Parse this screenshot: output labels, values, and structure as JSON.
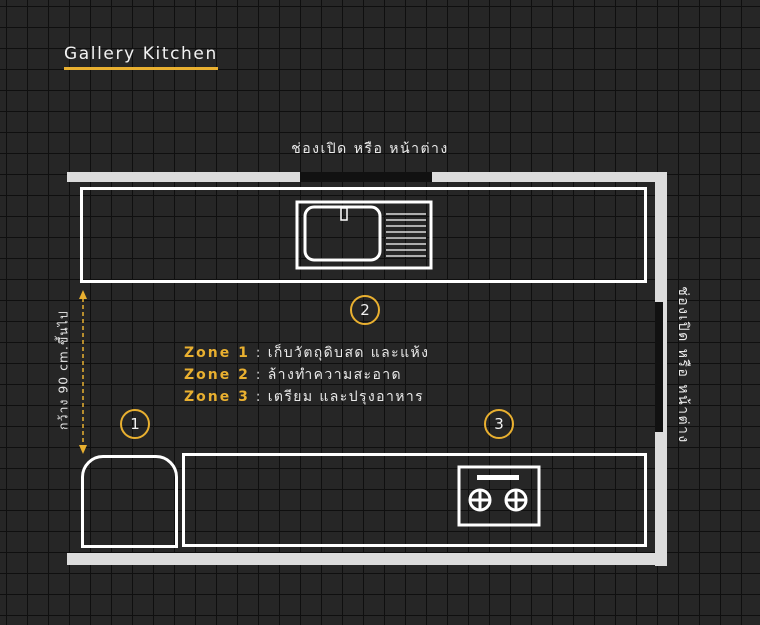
{
  "title": "Gallery Kitchen",
  "labels": {
    "top_opening": "ช่องเปิด หรือ หน้าต่าง",
    "right_opening": "ช่องเปิด หรือ หน้าต่าง",
    "width_note": "กว้าง 90 cm.ขึ้นไป"
  },
  "markers": [
    "1",
    "2",
    "3"
  ],
  "zones": [
    {
      "name": "Zone 1",
      "sep": ":",
      "desc": "เก็บวัตถุดิบสด และแห้ง"
    },
    {
      "name": "Zone 2",
      "sep": ":",
      "desc": "ล้างทำความสะอาด"
    },
    {
      "name": "Zone 3",
      "sep": ":",
      "desc": "เตรียม และปรุงอาหาร"
    }
  ],
  "colors": {
    "accent": "#e9b030",
    "lines": "#ffffff",
    "walls": "#dcdcdc"
  },
  "icons": [
    "sink-icon",
    "stove-icon",
    "refrigerator-icon",
    "dimension-arrow-icon"
  ]
}
